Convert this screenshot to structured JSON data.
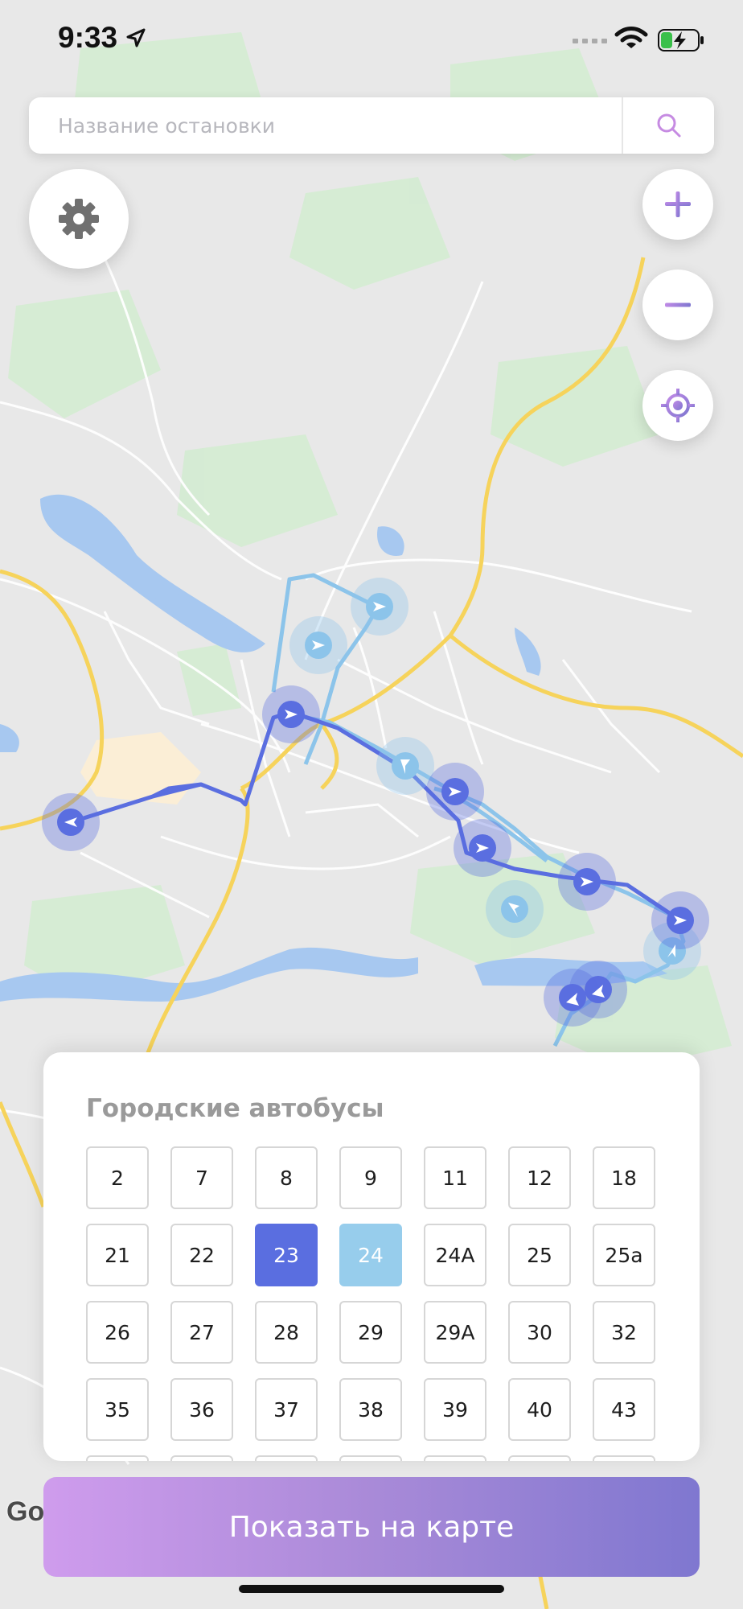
{
  "status_bar": {
    "time": "9:33"
  },
  "search": {
    "placeholder": "Название остановки"
  },
  "colors": {
    "accent_purple": "#9a73d8",
    "route_primary": "#5a6ee0",
    "route_secondary": "#97cdec",
    "button_gradient_start": "#cf9ced",
    "button_gradient_end": "#7f77d0"
  },
  "icons": {
    "settings": "gear-icon",
    "zoom_in": "plus-icon",
    "zoom_out": "minus-icon",
    "locate": "crosshair-icon",
    "search": "search-icon"
  },
  "map": {
    "attribution": "Go",
    "selected_routes": [
      "23",
      "24"
    ]
  },
  "panel": {
    "title": "Городские автобусы",
    "routes": [
      {
        "label": "2",
        "state": "normal"
      },
      {
        "label": "7",
        "state": "normal"
      },
      {
        "label": "8",
        "state": "normal"
      },
      {
        "label": "9",
        "state": "normal"
      },
      {
        "label": "11",
        "state": "normal"
      },
      {
        "label": "12",
        "state": "normal"
      },
      {
        "label": "18",
        "state": "normal"
      },
      {
        "label": "21",
        "state": "normal"
      },
      {
        "label": "22",
        "state": "normal"
      },
      {
        "label": "23",
        "state": "selected-primary"
      },
      {
        "label": "24",
        "state": "selected-secondary"
      },
      {
        "label": "24А",
        "state": "normal"
      },
      {
        "label": "25",
        "state": "normal"
      },
      {
        "label": "25а",
        "state": "normal"
      },
      {
        "label": "26",
        "state": "normal"
      },
      {
        "label": "27",
        "state": "normal"
      },
      {
        "label": "28",
        "state": "normal"
      },
      {
        "label": "29",
        "state": "normal"
      },
      {
        "label": "29А",
        "state": "normal"
      },
      {
        "label": "30",
        "state": "normal"
      },
      {
        "label": "32",
        "state": "normal"
      },
      {
        "label": "35",
        "state": "normal"
      },
      {
        "label": "36",
        "state": "normal"
      },
      {
        "label": "37",
        "state": "normal"
      },
      {
        "label": "38",
        "state": "normal"
      },
      {
        "label": "39",
        "state": "normal"
      },
      {
        "label": "40",
        "state": "normal"
      },
      {
        "label": "43",
        "state": "normal"
      },
      {
        "label": "",
        "state": "normal"
      },
      {
        "label": "",
        "state": "normal"
      },
      {
        "label": "",
        "state": "normal"
      },
      {
        "label": "",
        "state": "normal"
      },
      {
        "label": "",
        "state": "normal"
      },
      {
        "label": "",
        "state": "normal"
      },
      {
        "label": "",
        "state": "normal"
      }
    ]
  },
  "show_button": {
    "label": "Показать на карте"
  }
}
